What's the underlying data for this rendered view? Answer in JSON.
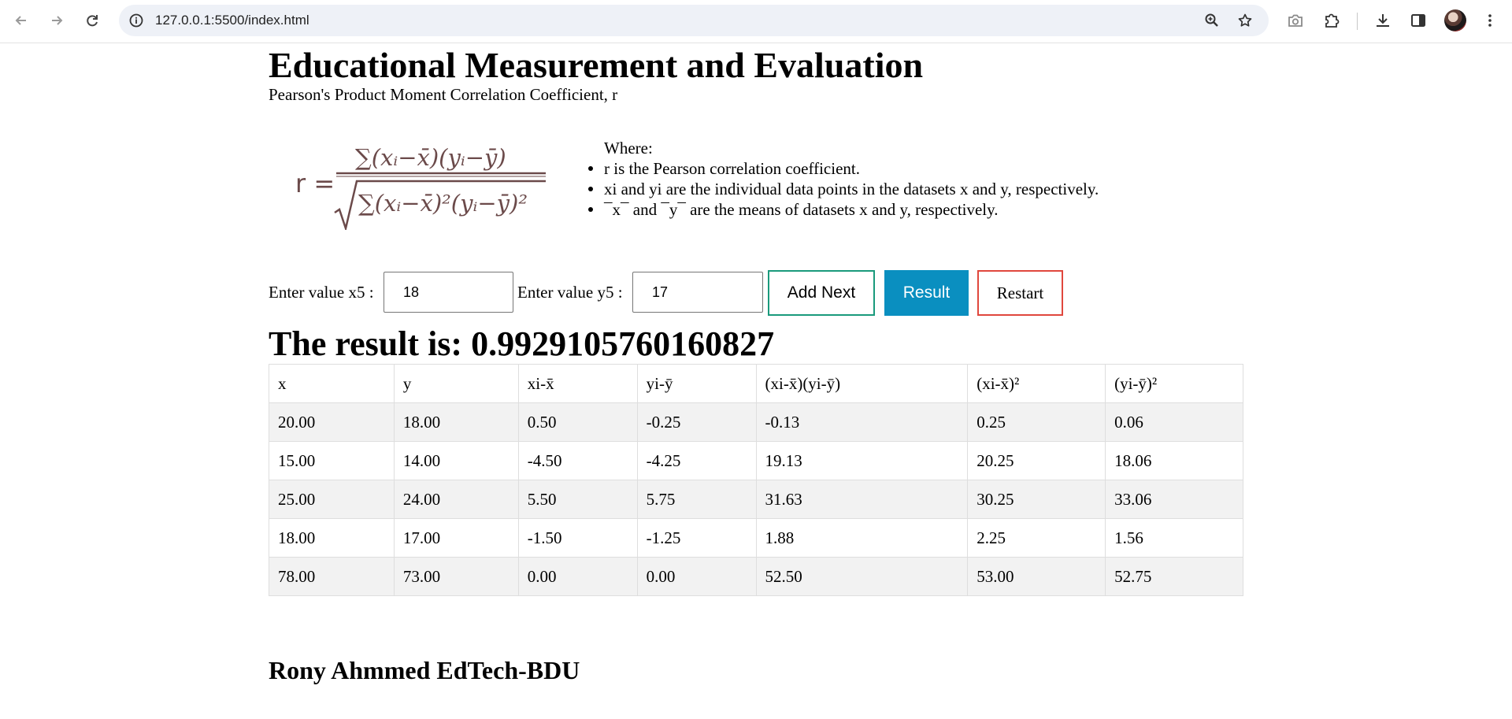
{
  "browser": {
    "url": "127.0.0.1:5500/index.html"
  },
  "page": {
    "title": "Educational Measurement and Evaluation",
    "subtitle": "Pearson's Product Moment Correlation Coefficient, r",
    "formula": {
      "lhs": "r =",
      "numerator": "∑(xᵢ−x̄)(yᵢ−ȳ)",
      "denominator": "∑(xᵢ−x̄)²(yᵢ−ȳ)²"
    },
    "where": {
      "heading": "Where:",
      "items": [
        "r is the Pearson correlation coefficient.",
        "xi and yi are the individual data points in the datasets x and y, respectively.",
        "¯x¯ and ¯y¯ are the means of datasets x and y, respectively."
      ]
    },
    "form": {
      "x_label": "Enter value x5 :",
      "x_value": "18",
      "y_label": "Enter value y5 :",
      "y_value": "17",
      "add_next": "Add Next",
      "result": "Result",
      "restart": "Restart"
    },
    "result_text": "The result is: 0.9929105760160827",
    "table": {
      "headers": [
        "x",
        "y",
        "xi-x̄",
        "yi-ȳ",
        "(xi-x̄)(yi-ȳ)",
        "(xi-x̄)²",
        "(yi-ȳ)²"
      ],
      "rows": [
        [
          "20.00",
          "18.00",
          "0.50",
          "-0.25",
          "-0.13",
          "0.25",
          "0.06"
        ],
        [
          "15.00",
          "14.00",
          "-4.50",
          "-4.25",
          "19.13",
          "20.25",
          "18.06"
        ],
        [
          "25.00",
          "24.00",
          "5.50",
          "5.75",
          "31.63",
          "30.25",
          "33.06"
        ],
        [
          "18.00",
          "17.00",
          "-1.50",
          "-1.25",
          "1.88",
          "2.25",
          "1.56"
        ],
        [
          "78.00",
          "73.00",
          "0.00",
          "0.00",
          "52.50",
          "53.00",
          "52.75"
        ]
      ]
    },
    "footer": "Rony Ahmmed EdTech-BDU"
  },
  "colors": {
    "add_border": "#1a9a7c",
    "result_bg": "#0a8fc0",
    "restart_border": "#e0473d",
    "formula_color": "#6b4a4a"
  }
}
